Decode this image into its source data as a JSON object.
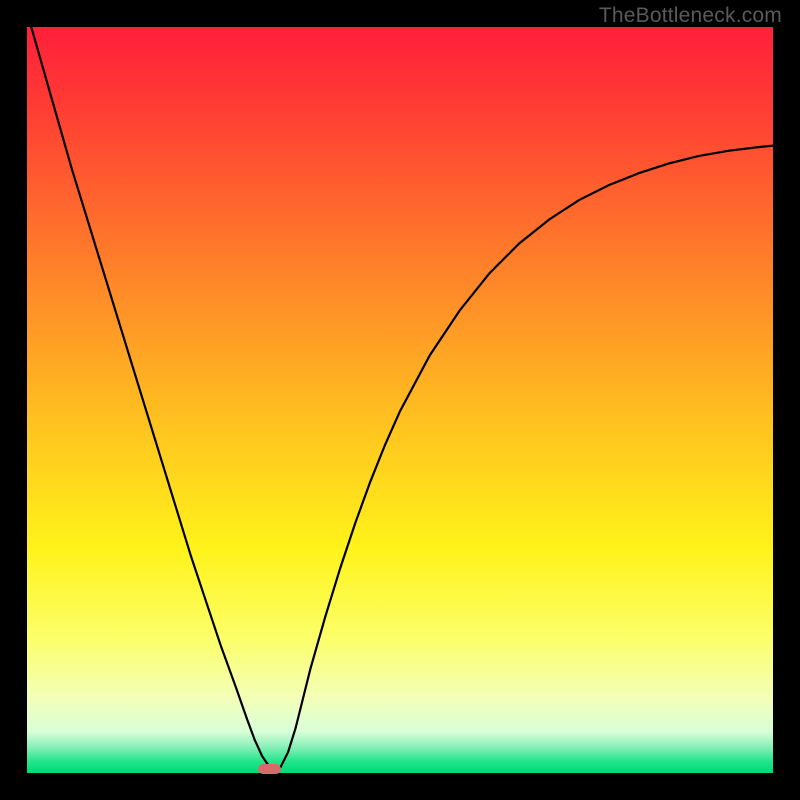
{
  "watermark": "TheBottleneck.com",
  "chart_data": {
    "type": "line",
    "title": "",
    "xlabel": "",
    "ylabel": "",
    "xlim": [
      0,
      100
    ],
    "ylim": [
      0,
      100
    ],
    "background_gradient": {
      "stops": [
        {
          "pos": 0.0,
          "color": "#ff1f3a"
        },
        {
          "pos": 0.1,
          "color": "#ff3a34"
        },
        {
          "pos": 0.25,
          "color": "#ff6a2d"
        },
        {
          "pos": 0.4,
          "color": "#ff9926"
        },
        {
          "pos": 0.55,
          "color": "#ffc81f"
        },
        {
          "pos": 0.7,
          "color": "#fff31a"
        },
        {
          "pos": 0.82,
          "color": "#fcff6a"
        },
        {
          "pos": 0.9,
          "color": "#f3ffb8"
        },
        {
          "pos": 0.945,
          "color": "#d8ffd8"
        },
        {
          "pos": 0.965,
          "color": "#88f0b8"
        },
        {
          "pos": 0.985,
          "color": "#20e58a"
        },
        {
          "pos": 1.0,
          "color": "#00d877"
        }
      ]
    },
    "series": [
      {
        "name": "bottleneck-curve",
        "color": "#000000",
        "x": [
          0.0,
          2.0,
          4.0,
          6.0,
          8.0,
          10.0,
          12.0,
          14.0,
          16.0,
          18.0,
          20.0,
          22.0,
          24.0,
          26.0,
          28.0,
          29.5,
          30.5,
          31.5,
          32.5,
          33.0,
          34.0,
          35.0,
          36.0,
          37.0,
          38.0,
          40.0,
          42.0,
          44.0,
          46.0,
          48.0,
          50.0,
          54.0,
          58.0,
          62.0,
          66.0,
          70.0,
          74.0,
          78.0,
          82.0,
          86.0,
          90.0,
          94.0,
          98.0,
          100.0
        ],
        "y": [
          102.0,
          95.0,
          88.0,
          81.0,
          74.5,
          68.0,
          61.5,
          55.0,
          48.5,
          42.0,
          35.5,
          29.0,
          23.0,
          17.0,
          11.5,
          7.2,
          4.5,
          2.3,
          0.8,
          0.2,
          0.8,
          2.8,
          6.0,
          10.0,
          14.0,
          21.0,
          27.5,
          33.5,
          39.0,
          44.0,
          48.5,
          56.0,
          62.0,
          67.0,
          71.0,
          74.2,
          76.8,
          78.8,
          80.4,
          81.7,
          82.7,
          83.4,
          83.9,
          84.1
        ]
      }
    ],
    "markers": [
      {
        "name": "optimal-point",
        "x": 32.5,
        "y": 0.5,
        "color": "#d86a6a",
        "w": 3.2,
        "h": 1.4
      }
    ]
  }
}
